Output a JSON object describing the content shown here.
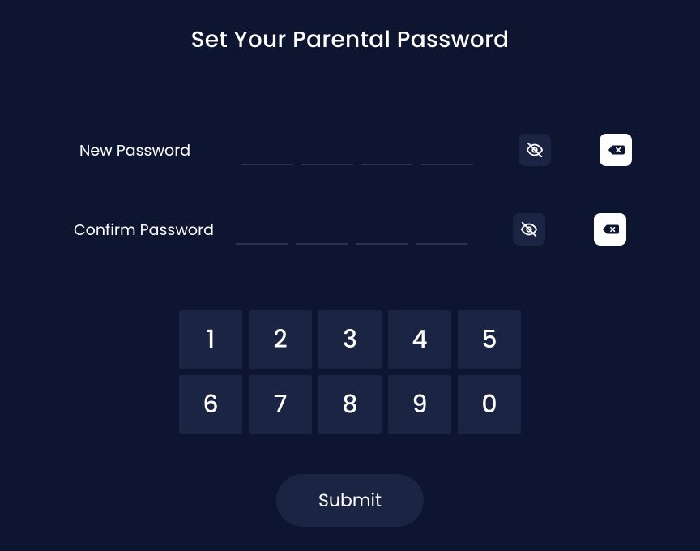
{
  "title": "Set Your Parental Password",
  "fields": {
    "new_password_label": "New Password",
    "confirm_password_label": "Confirm Password"
  },
  "keypad": {
    "keys": [
      "1",
      "2",
      "3",
      "4",
      "5",
      "6",
      "7",
      "8",
      "9",
      "0"
    ]
  },
  "submit_label": "Submit",
  "colors": {
    "background": "#0e1530",
    "tile": "#1b2442",
    "icon_light_bg": "#ffffff",
    "underline": "#2a334f"
  },
  "icons": {
    "eye_off": "eye-off-icon",
    "backspace": "backspace-icon"
  }
}
